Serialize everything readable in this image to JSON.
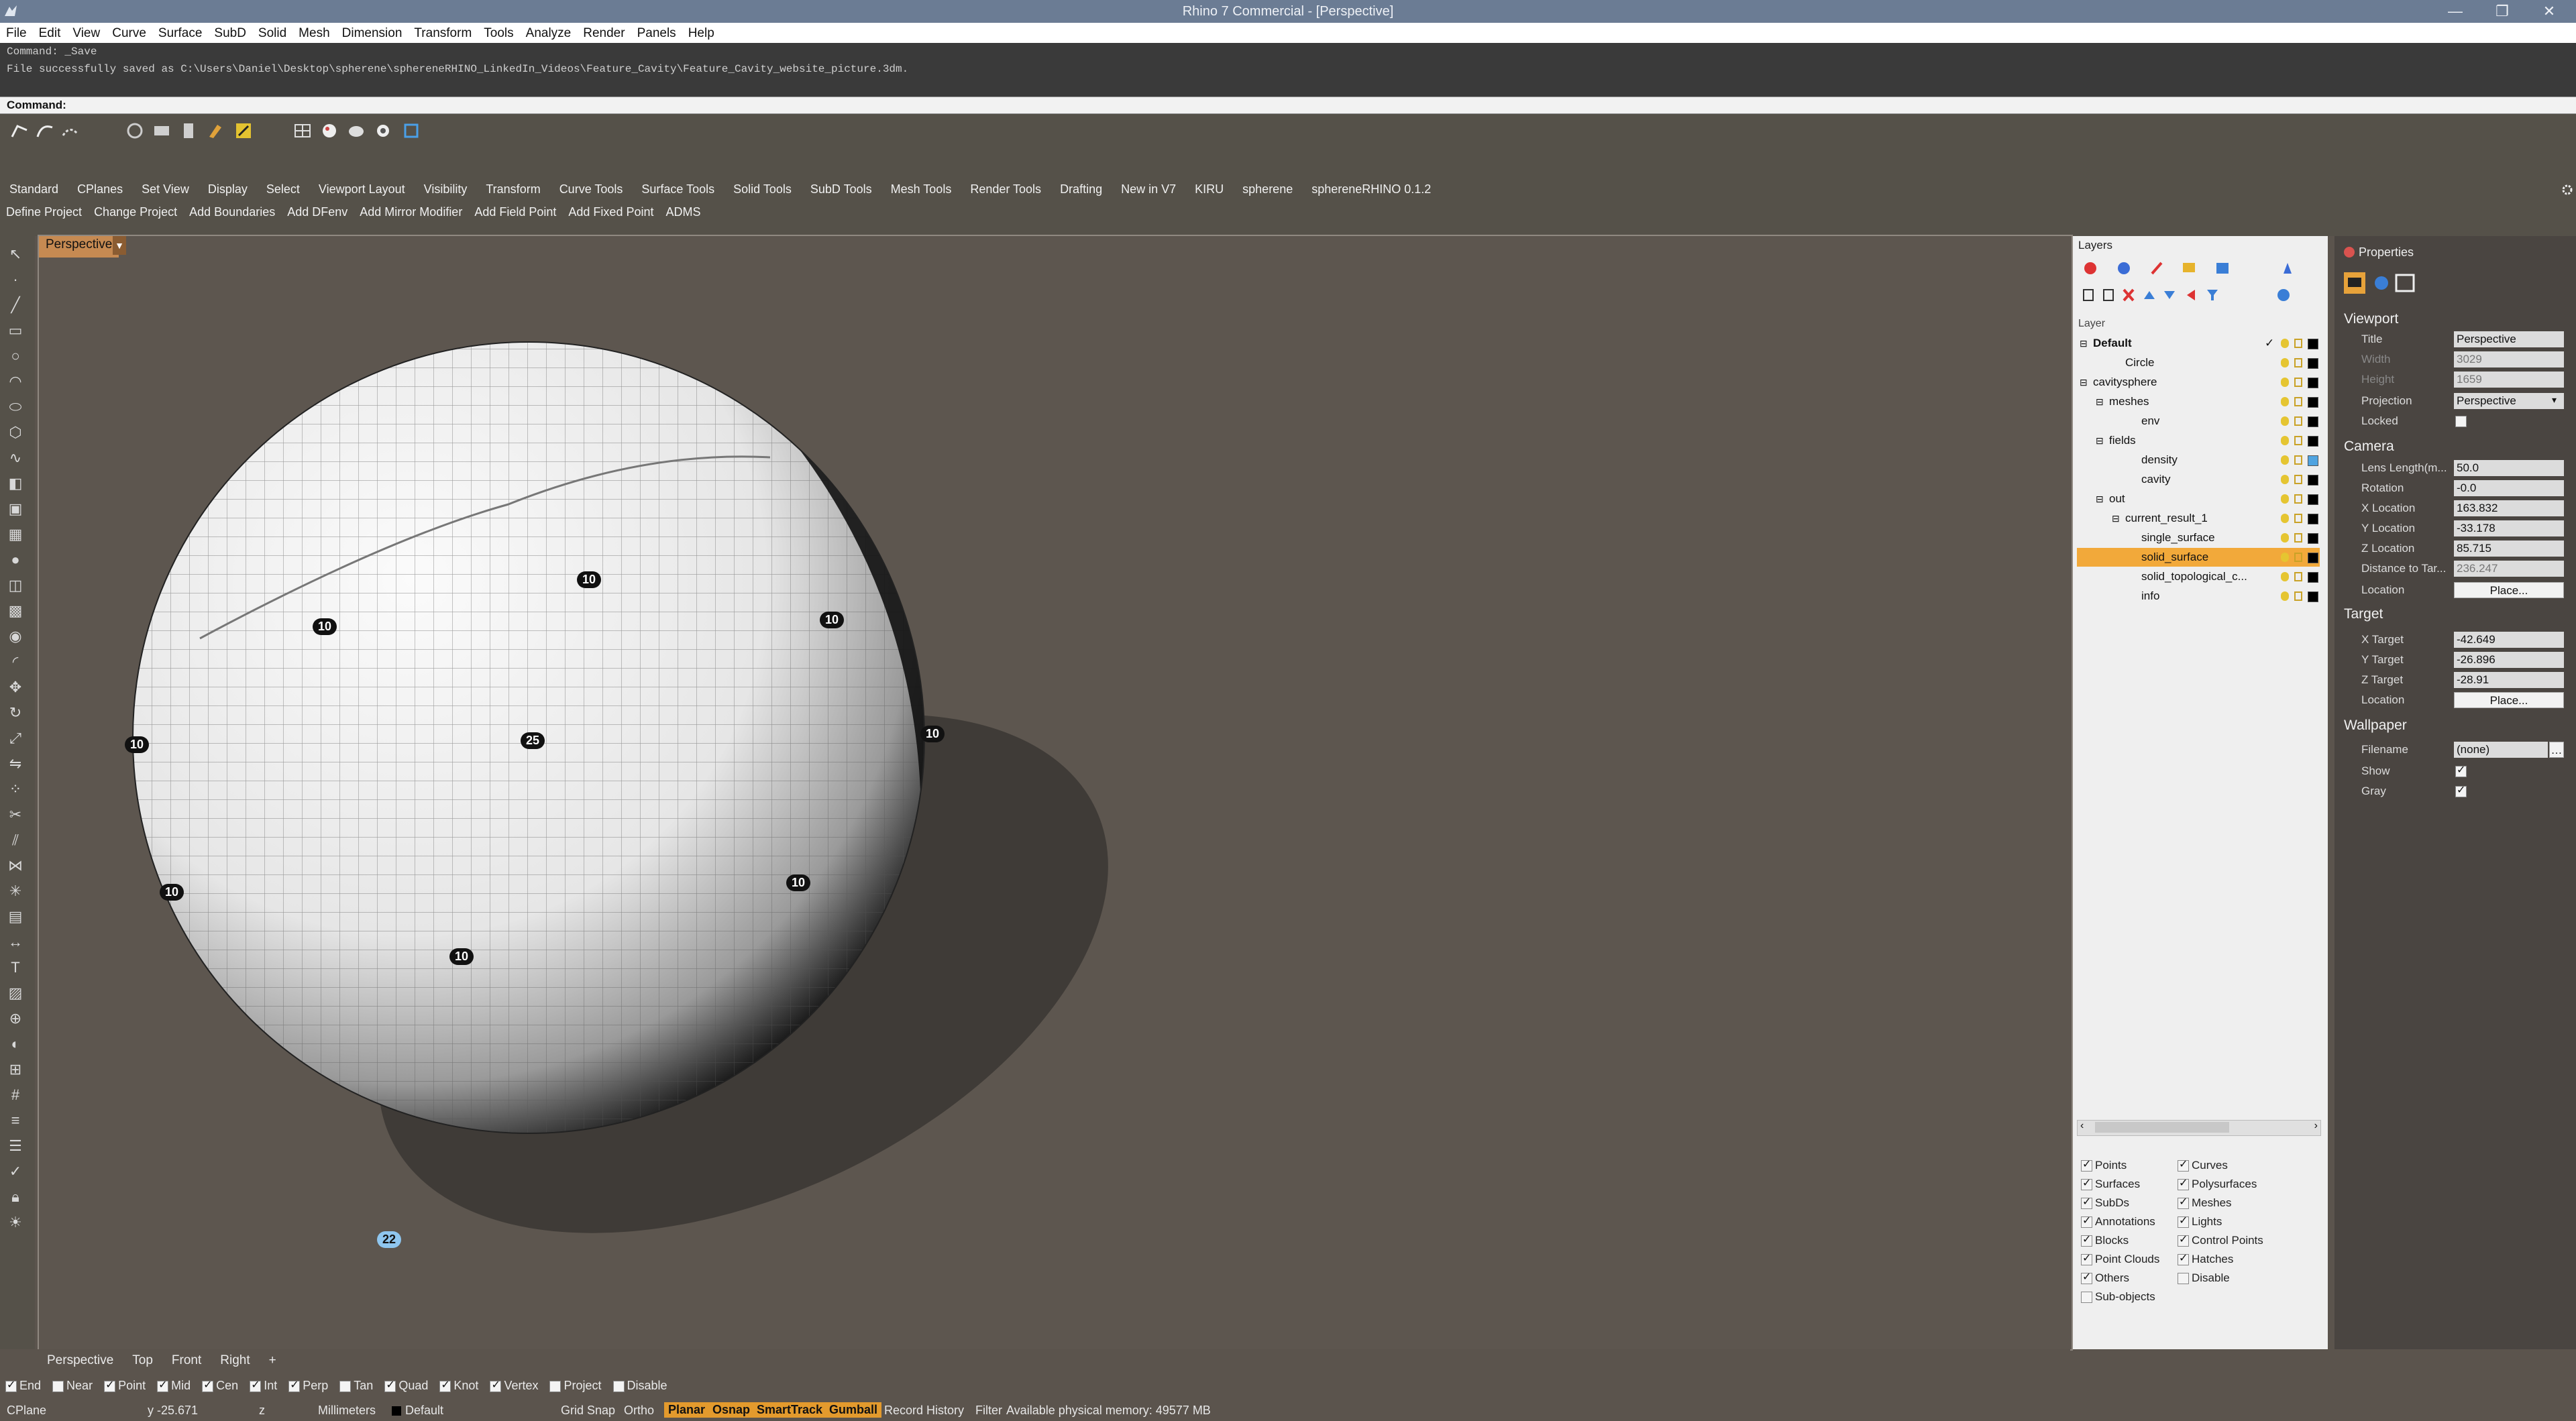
{
  "titlebar": {
    "title": "Rhino 7 Commercial - [Perspective]",
    "min": "—",
    "max": "❐",
    "close": "✕"
  },
  "menu": [
    "File",
    "Edit",
    "View",
    "Curve",
    "Surface",
    "SubD",
    "Solid",
    "Mesh",
    "Dimension",
    "Transform",
    "Tools",
    "Analyze",
    "Render",
    "Panels",
    "Help"
  ],
  "command_history": [
    "Command: _Save",
    "File successfully saved as C:\\Users\\Daniel\\Desktop\\spherene\\sphereneRHINO_LinkedIn_Videos\\Feature_Cavity\\Feature_Cavity_website_picture.3dm."
  ],
  "command_prompt": "Command:",
  "toolbar_tabs": [
    "Standard",
    "CPlanes",
    "Set View",
    "Display",
    "Select",
    "Viewport Layout",
    "Visibility",
    "Transform",
    "Curve Tools",
    "Surface Tools",
    "Solid Tools",
    "SubD Tools",
    "Mesh Tools",
    "Render Tools",
    "Drafting",
    "New in V7",
    "KIRU",
    "spherene",
    "sphereneRHINO 0.1.2"
  ],
  "plugin_tabs": [
    "Define Project",
    "Change Project",
    "Add Boundaries",
    "Add DFenv",
    "Add Mirror Modifier",
    "Add Field Point",
    "Add Fixed Point",
    "ADMS"
  ],
  "viewport": {
    "name": "Perspective",
    "badges": [
      "10",
      "10",
      "10",
      "10",
      "25",
      "10",
      "10",
      "10",
      "10",
      "22"
    ]
  },
  "viewport_tabs": [
    "Perspective",
    "Top",
    "Front",
    "Right",
    "+"
  ],
  "osnaps": [
    {
      "label": "End",
      "on": true
    },
    {
      "label": "Near",
      "on": false
    },
    {
      "label": "Point",
      "on": true
    },
    {
      "label": "Mid",
      "on": true
    },
    {
      "label": "Cen",
      "on": true
    },
    {
      "label": "Int",
      "on": true
    },
    {
      "label": "Perp",
      "on": true
    },
    {
      "label": "Tan",
      "on": false
    },
    {
      "label": "Quad",
      "on": true
    },
    {
      "label": "Knot",
      "on": true
    },
    {
      "label": "Vertex",
      "on": true
    },
    {
      "label": "Project",
      "on": false
    },
    {
      "label": "Disable",
      "on": false
    }
  ],
  "status": {
    "cplane": "CPlane",
    "y": "y -25.671",
    "z": "z",
    "units": "Millimeters",
    "layer": "Default",
    "grid_snap": "Grid Snap",
    "ortho": "Ortho",
    "planar": "Planar",
    "osnap": "Osnap",
    "smarttrack": "SmartTrack",
    "gumball": "Gumball",
    "record_history": "Record History",
    "filter": "Filter",
    "memory": "Available physical memory: 49577 MB"
  },
  "layers": {
    "panel_title": "Layers",
    "column_header": "Layer",
    "rows": [
      {
        "name": "Default",
        "indent": 0,
        "bold": true,
        "expand": "⊟",
        "check": "✓",
        "swatch": "#000000"
      },
      {
        "name": "Circle",
        "indent": 2,
        "expand": "",
        "swatch": "#000000"
      },
      {
        "name": "cavitysphere",
        "indent": 0,
        "expand": "⊟",
        "swatch": "#000000"
      },
      {
        "name": "meshes",
        "indent": 1,
        "expand": "⊟",
        "swatch": "#000000"
      },
      {
        "name": "env",
        "indent": 3,
        "expand": "",
        "swatch": "#000000"
      },
      {
        "name": "fields",
        "indent": 1,
        "expand": "⊟",
        "swatch": "#000000"
      },
      {
        "name": "density",
        "indent": 3,
        "expand": "",
        "swatch": "#4fa3e0"
      },
      {
        "name": "cavity",
        "indent": 3,
        "expand": "",
        "swatch": "#000000"
      },
      {
        "name": "out",
        "indent": 1,
        "expand": "⊟",
        "swatch": "#000000"
      },
      {
        "name": "current_result_1",
        "indent": 2,
        "expand": "⊟",
        "swatch": "#000000"
      },
      {
        "name": "single_surface",
        "indent": 3,
        "expand": "",
        "swatch": "#000000"
      },
      {
        "name": "solid_surface",
        "indent": 3,
        "expand": "",
        "swatch": "#000000",
        "selected": true
      },
      {
        "name": "solid_topological_c...",
        "indent": 3,
        "expand": "",
        "swatch": "#000000"
      },
      {
        "name": "info",
        "indent": 3,
        "expand": "",
        "swatch": "#000000"
      }
    ],
    "filters": [
      {
        "label": "Points",
        "on": true
      },
      {
        "label": "Curves",
        "on": true
      },
      {
        "label": "Surfaces",
        "on": true
      },
      {
        "label": "Polysurfaces",
        "on": true
      },
      {
        "label": "SubDs",
        "on": true
      },
      {
        "label": "Meshes",
        "on": true
      },
      {
        "label": "Annotations",
        "on": true
      },
      {
        "label": "Lights",
        "on": true
      },
      {
        "label": "Blocks",
        "on": true
      },
      {
        "label": "Control Points",
        "on": true
      },
      {
        "label": "Point Clouds",
        "on": true
      },
      {
        "label": "Hatches",
        "on": true
      },
      {
        "label": "Others",
        "on": true
      },
      {
        "label": "Disable",
        "on": false
      },
      {
        "label": "Sub-objects",
        "on": false
      }
    ]
  },
  "properties": {
    "panel_title": "Properties",
    "viewport_section": "Viewport",
    "title_label": "Title",
    "title_value": "Perspective",
    "width_label": "Width",
    "width_value": "3029",
    "height_label": "Height",
    "height_value": "1659",
    "projection_label": "Projection",
    "projection_value": "Perspective",
    "locked_label": "Locked",
    "camera_section": "Camera",
    "lens_label": "Lens Length(m...",
    "lens_value": "50.0",
    "rotation_label": "Rotation",
    "rotation_value": "-0.0",
    "xloc_label": "X Location",
    "xloc_value": "163.832",
    "yloc_label": "Y Location",
    "yloc_value": "-33.178",
    "zloc_label": "Z Location",
    "zloc_value": "85.715",
    "dist_label": "Distance to Tar...",
    "dist_value": "236.247",
    "loc_label": "Location",
    "place_button": "Place...",
    "target_section": "Target",
    "xt_label": "X Target",
    "xt_value": "-42.649",
    "yt_label": "Y Target",
    "yt_value": "-26.896",
    "zt_label": "Z Target",
    "zt_value": "-28.91",
    "tloc_label": "Location",
    "tplace_button": "Place...",
    "wallpaper_section": "Wallpaper",
    "filename_label": "Filename",
    "filename_value": "(none)",
    "show_label": "Show",
    "gray_label": "Gray"
  }
}
